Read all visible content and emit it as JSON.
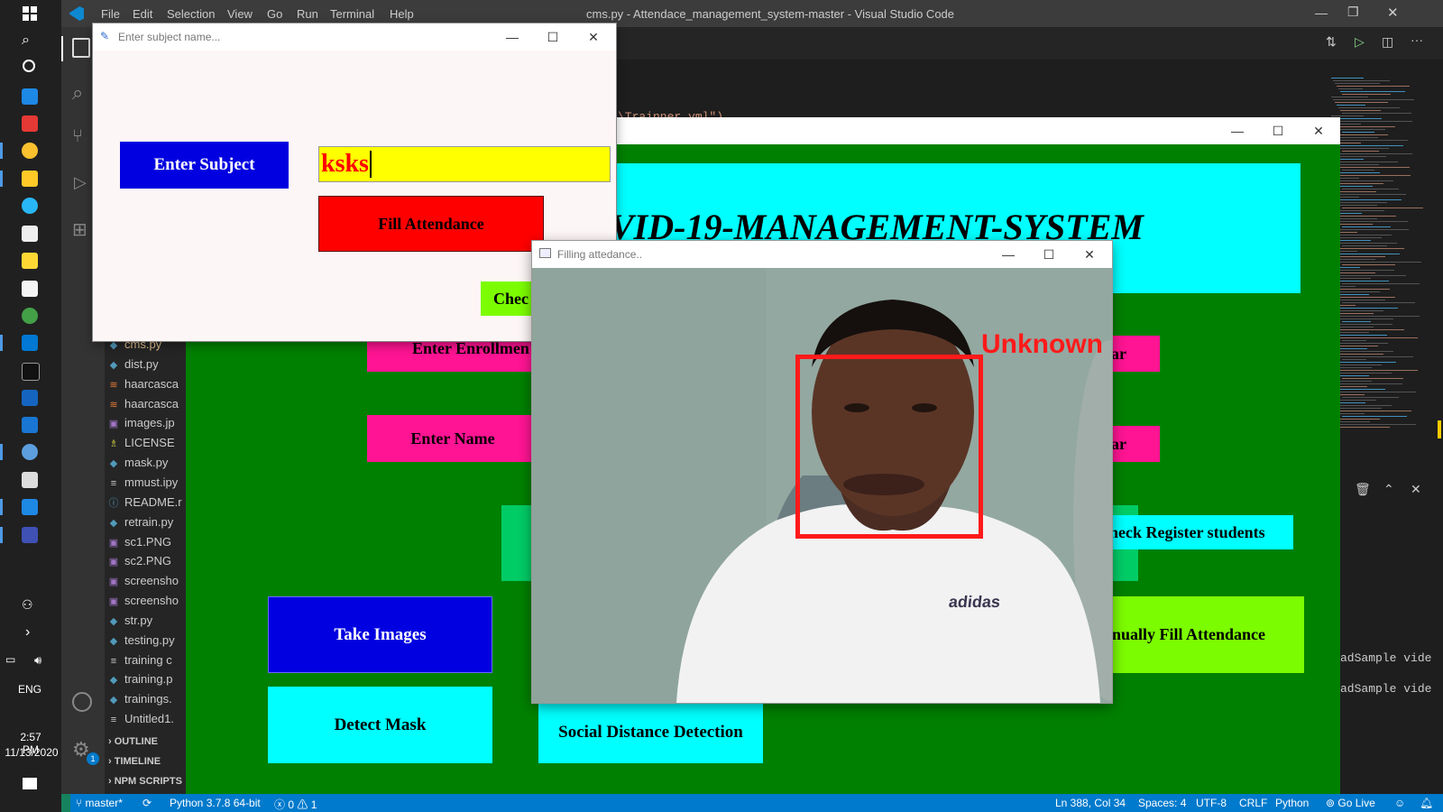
{
  "taskbar": {
    "language": "ENG",
    "time": "2:57 PM",
    "date": "11/13/2020"
  },
  "vscode": {
    "menu": [
      "File",
      "Edit",
      "Selection",
      "View",
      "Go",
      "Run",
      "Terminal",
      "Help"
    ],
    "title": "cms.py - Attendace_management_system-master - Visual Studio Code",
    "editor_snippet": "\\Trainner.yml\")",
    "files": [
      {
        "name": "cms.py",
        "icon": "python-icon"
      },
      {
        "name": "dist.py",
        "icon": "python-icon"
      },
      {
        "name": "haarcasca",
        "icon": "xml-icon"
      },
      {
        "name": "haarcasca",
        "icon": "xml-icon"
      },
      {
        "name": "images.jp",
        "icon": "image-icon"
      },
      {
        "name": "LICENSE",
        "icon": "license-icon"
      },
      {
        "name": "mask.py",
        "icon": "python-icon"
      },
      {
        "name": "mmust.ipy",
        "icon": "lines-icon"
      },
      {
        "name": "README.r",
        "icon": "info-icon"
      },
      {
        "name": "retrain.py",
        "icon": "python-icon"
      },
      {
        "name": "sc1.PNG",
        "icon": "image-icon"
      },
      {
        "name": "sc2.PNG",
        "icon": "image-icon"
      },
      {
        "name": "screensho",
        "icon": "image-icon"
      },
      {
        "name": "screensho",
        "icon": "image-icon"
      },
      {
        "name": "str.py",
        "icon": "python-icon"
      },
      {
        "name": "testing.py",
        "icon": "python-icon"
      },
      {
        "name": "training c",
        "icon": "lines-icon"
      },
      {
        "name": "training.p",
        "icon": "python-icon"
      },
      {
        "name": "trainings.",
        "icon": "python-icon"
      },
      {
        "name": "Untitled1.",
        "icon": "lines-icon"
      }
    ],
    "sections": [
      "OUTLINE",
      "TIMELINE",
      "NPM SCRIPTS"
    ],
    "terminal_lines": [
      "adSample vide",
      "adSample vide"
    ],
    "status": {
      "branch": "master*",
      "python": "Python 3.7.8 64-bit",
      "errors": "0",
      "warnings": "1",
      "position": "Ln 388, Col 34",
      "spaces": "Spaces: 4",
      "encoding": "UTF-8",
      "eol": "CRLF",
      "language": "Python",
      "golive": "Go Live"
    }
  },
  "main_app": {
    "title": "VID-19-MANAGEMENT-SYSTEM",
    "buttons": {
      "enter_enrollment": "Enter Enrollmen",
      "clear1": "ar",
      "enter_name": "Enter Name",
      "clear2": "ar",
      "check_register": "heck Register students",
      "take_images": "Take Images",
      "manually_fill": "anually Fill Attendance",
      "detect_mask": "Detect Mask",
      "social_distance": "Social Distance Detection"
    },
    "colors": {
      "bg": "#008000",
      "title_bg": "#00ffff",
      "pink": "#ff1493",
      "blue": "#0000e0",
      "lime": "#7cfc00",
      "cyan": "#00ffff"
    }
  },
  "subject_window": {
    "title": "Enter subject name...",
    "enter_subject_label": "Enter Subject",
    "subject_value": "ksks",
    "fill_attendance_label": "Fill Attendance",
    "check_label": "Chec"
  },
  "camera_window": {
    "title": "Filling attedance..",
    "face_label": "Unknown",
    "shirt_brand": "adidas"
  }
}
